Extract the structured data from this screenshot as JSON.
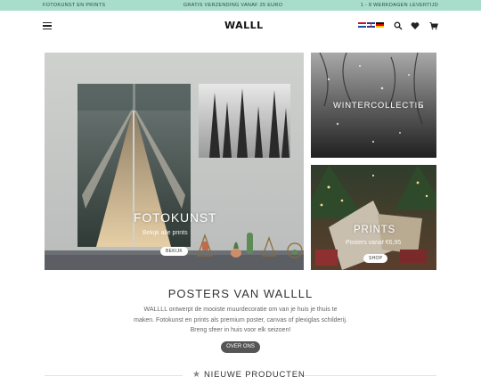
{
  "topbar": {
    "left": "FOTOKUNST EN PRINTS",
    "center": "GRATIS VERZENDING VANAF 25 EURO",
    "right": "1 - 8 WERKDAGEN LEVERTIJD"
  },
  "header": {
    "logo": "WALLL",
    "languages": [
      "nl",
      "en",
      "de"
    ],
    "icons": [
      "menu-icon",
      "search-icon",
      "heart-icon",
      "cart-icon"
    ]
  },
  "tiles": {
    "main": {
      "title": "FOTOKUNST",
      "subtitle": "Bekijk alle prints",
      "button": "BEKIJK"
    },
    "winter": {
      "title": "WINTERCOLLECTIE"
    },
    "prints": {
      "title": "PRINTS",
      "subtitle": "Posters vanaf €6,95",
      "button": "SHOP"
    }
  },
  "intro": {
    "heading": "POSTERS VAN WALLLL",
    "text": "WALLLL ontwerpt de mooiste muurdecoratie om van je huis je thuis te maken. Fotokunst en prints als premium poster, canvas of plexiglas schilderij. Breng sfeer in huis voor elk seizoen!",
    "button": "OVER ONS"
  },
  "products": {
    "heading": "NIEUWE PRODUCTEN"
  },
  "colors": {
    "topbar": "#a8dccb",
    "button_dark": "#555555"
  }
}
